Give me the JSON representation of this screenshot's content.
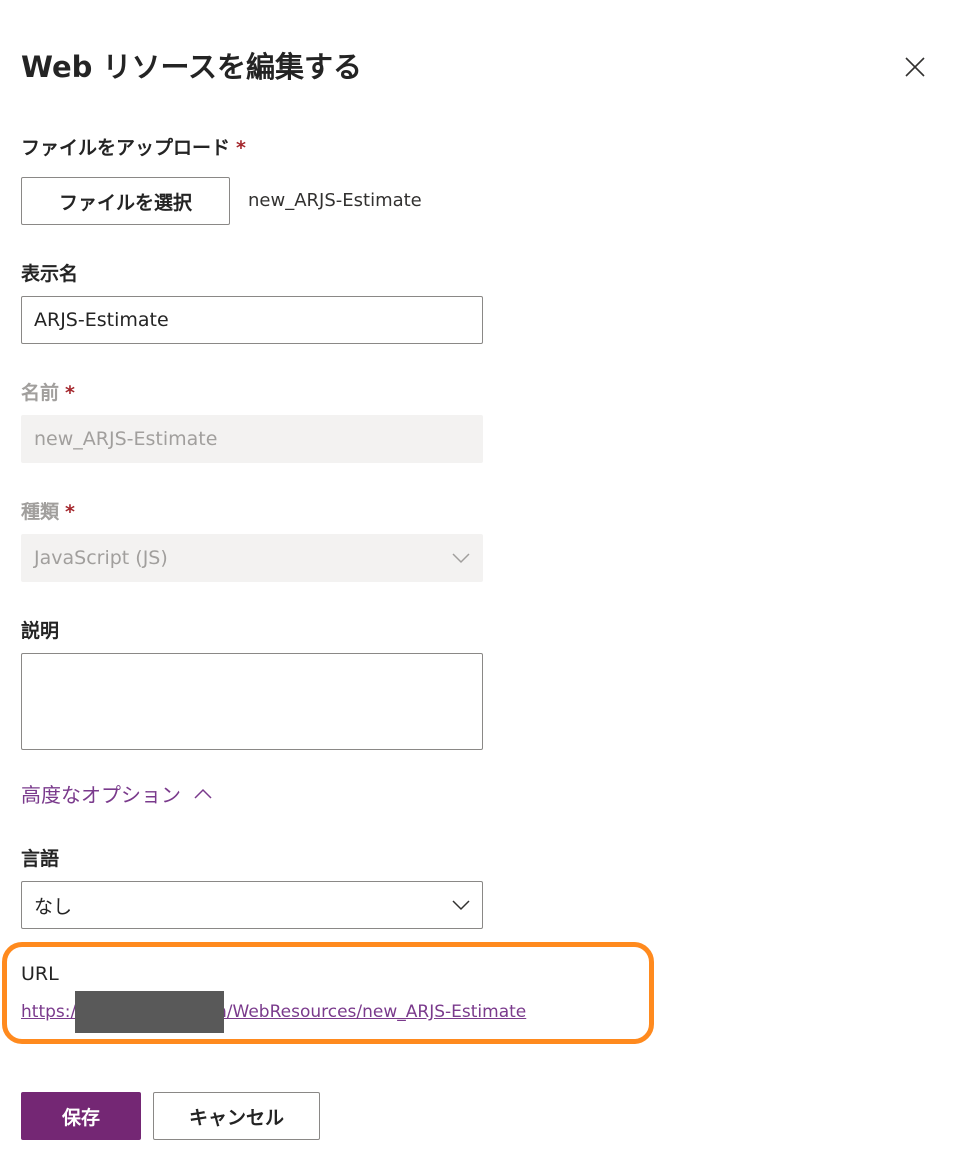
{
  "dialog": {
    "title": "Web リソースを編集する"
  },
  "upload": {
    "label": "ファイルをアップロード",
    "required_mark": "*",
    "button_label": "ファイルを選択",
    "file_name": "new_ARJS-Estimate"
  },
  "display_name": {
    "label": "表示名",
    "value": "ARJS-Estimate"
  },
  "name": {
    "label": "名前",
    "required_mark": "*",
    "value": "new_ARJS-Estimate"
  },
  "type": {
    "label": "種類",
    "required_mark": "*",
    "selected": "JavaScript (JS)"
  },
  "description": {
    "label": "説明",
    "value": ""
  },
  "advanced": {
    "toggle_label": "高度なオプション"
  },
  "language": {
    "label": "言語",
    "selected": "なし"
  },
  "url": {
    "label": "URL",
    "link_text": "https://                    7.dynamics.com/WebResources/new_ARJS-Estimate"
  },
  "actions": {
    "save_label": "保存",
    "cancel_label": "キャンセル"
  },
  "colors": {
    "accent_purple": "#742774",
    "link_purple": "#7a3a8c",
    "required_red": "#a4262c",
    "highlight_orange": "#ff8a1e"
  },
  "icons": {
    "close": "close-icon",
    "chevron_down": "chevron-down-icon",
    "chevron_up": "chevron-up-icon"
  }
}
